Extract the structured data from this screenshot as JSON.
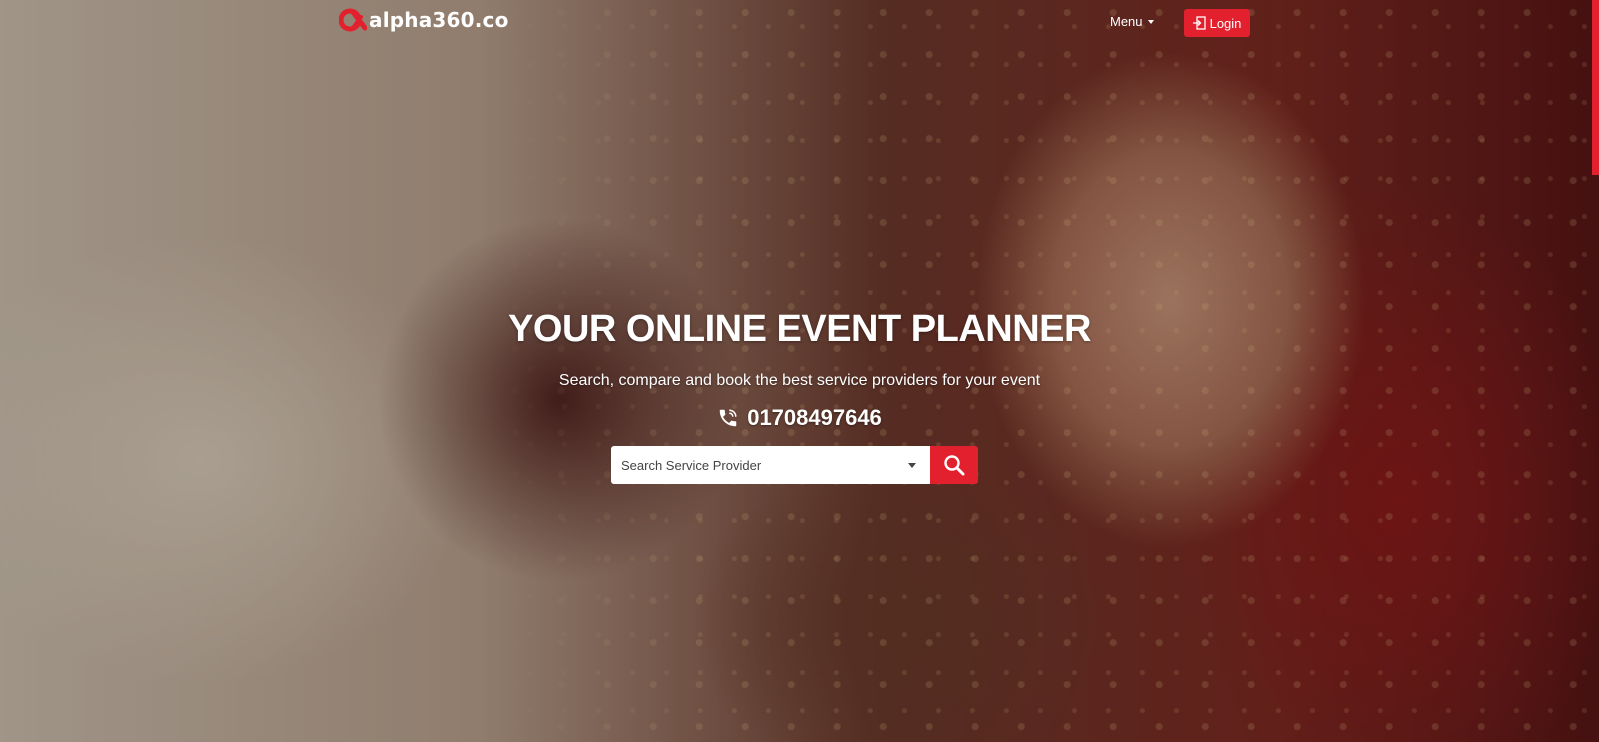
{
  "header": {
    "logo_text": "alpha360.co",
    "menu_label": "Menu",
    "login_label": "Login"
  },
  "hero": {
    "title": "YOUR ONLINE EVENT PLANNER",
    "subtitle": "Search, compare and book the best service providers for your event",
    "phone": "01708497646"
  },
  "search": {
    "placeholder": "Search Service Provider"
  },
  "icons": {
    "logo": "alpha-logo-icon",
    "login": "login-icon",
    "phone": "phone-icon",
    "search": "search-icon",
    "dropdown": "chevron-down-icon"
  },
  "colors": {
    "accent": "#e2202e",
    "text_on_dark": "#ffffff"
  }
}
